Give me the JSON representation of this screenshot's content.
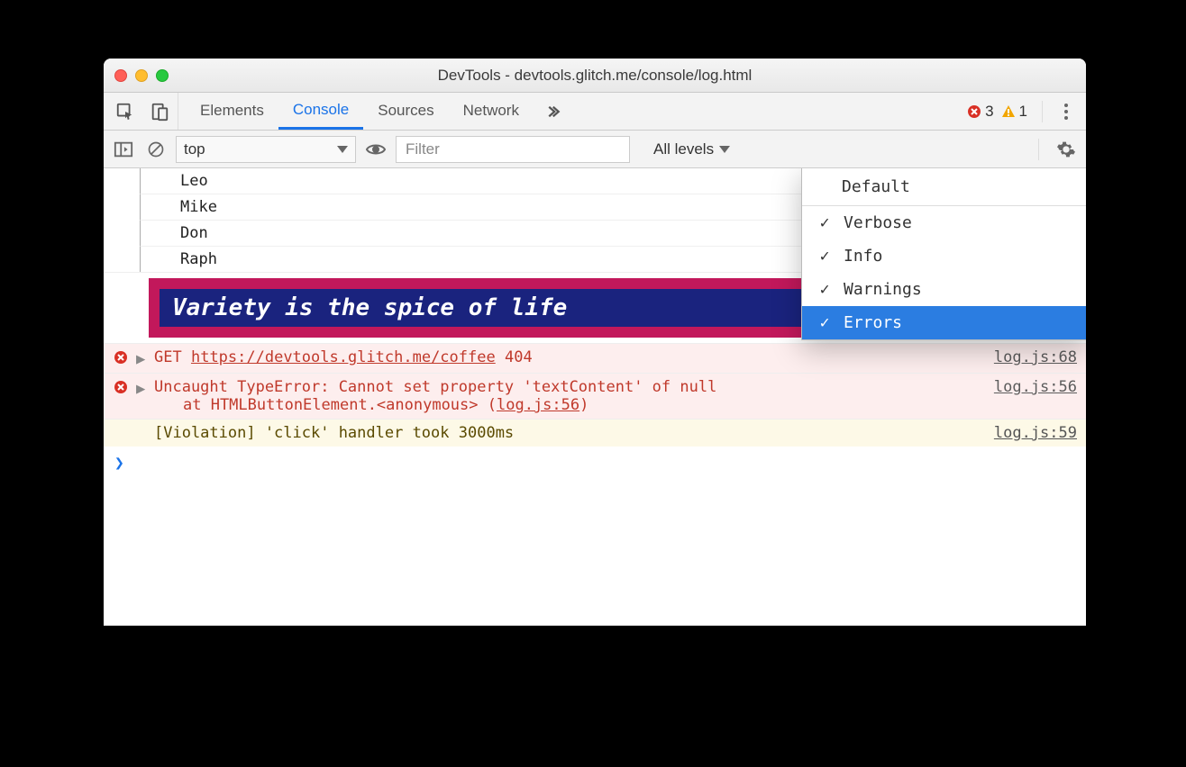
{
  "window": {
    "title": "DevTools - devtools.glitch.me/console/log.html"
  },
  "tabs": {
    "items": [
      "Elements",
      "Console",
      "Sources",
      "Network"
    ],
    "active_index": 1
  },
  "badges": {
    "errors": "3",
    "warnings": "1"
  },
  "toolbar": {
    "context": "top",
    "filter_placeholder": "Filter",
    "levels_label": "All levels"
  },
  "levels_menu": {
    "header": "Default",
    "items": [
      {
        "label": "Verbose",
        "checked": true,
        "selected": false
      },
      {
        "label": "Info",
        "checked": true,
        "selected": false
      },
      {
        "label": "Warnings",
        "checked": true,
        "selected": false
      },
      {
        "label": "Errors",
        "checked": true,
        "selected": true
      }
    ]
  },
  "log_group": [
    "Leo",
    "Mike",
    "Don",
    "Raph"
  ],
  "styled_message": "Variety is the spice of life",
  "rows": [
    {
      "type": "error",
      "prefix": "GET",
      "url": "https://devtools.glitch.me/coffee",
      "status": "404",
      "link": "log.js:68"
    },
    {
      "type": "error",
      "message": "Uncaught TypeError: Cannot set property 'textContent' of null",
      "stack_prefix": "at HTMLButtonElement.<anonymous> (",
      "stack_link": "log.js:56",
      "stack_suffix": ")",
      "link": "log.js:56"
    },
    {
      "type": "warn",
      "message": "[Violation] 'click' handler took 3000ms",
      "link": "log.js:59"
    }
  ],
  "prompt": "❯"
}
